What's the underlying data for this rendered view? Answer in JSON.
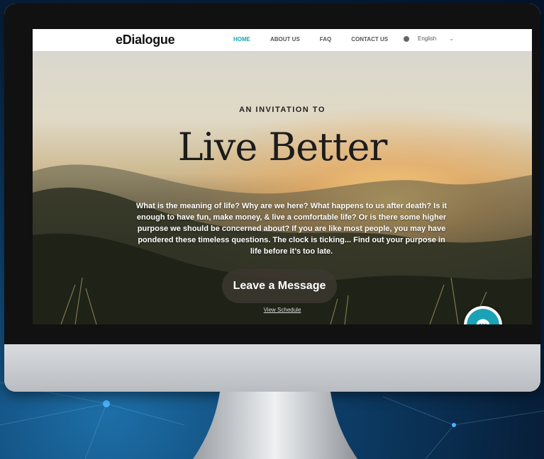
{
  "nav": {
    "logo": "eDialogue",
    "items": [
      {
        "label": "HOME",
        "active": true
      },
      {
        "label": "ABOUT US",
        "active": false
      },
      {
        "label": "FAQ",
        "active": false
      },
      {
        "label": "CONTACT US",
        "active": false
      }
    ],
    "language": "English"
  },
  "hero": {
    "kicker": "AN INVITATION TO",
    "headline": "Live Better",
    "body": "What is the meaning of life? Why are we here? What happens to us after death? Is it enough to have fun, make money, & live a comfortable life? Or is there some higher purpose we should be concerned about? If you are like most people, you may have pondered these timeless questions. The clock is ticking... Find out your purpose in life before it’s too late.",
    "cta_label": "Leave a Message",
    "schedule_link": "View Schedule"
  },
  "colors": {
    "accent": "#1aa3b7",
    "cta_bg": "#3c3730"
  },
  "icons": {
    "globe": "globe-icon",
    "language_dropdown": "chevron-down-icon",
    "scroll_down": "chevron-down-icon",
    "chat": "chat-bubble-icon"
  }
}
